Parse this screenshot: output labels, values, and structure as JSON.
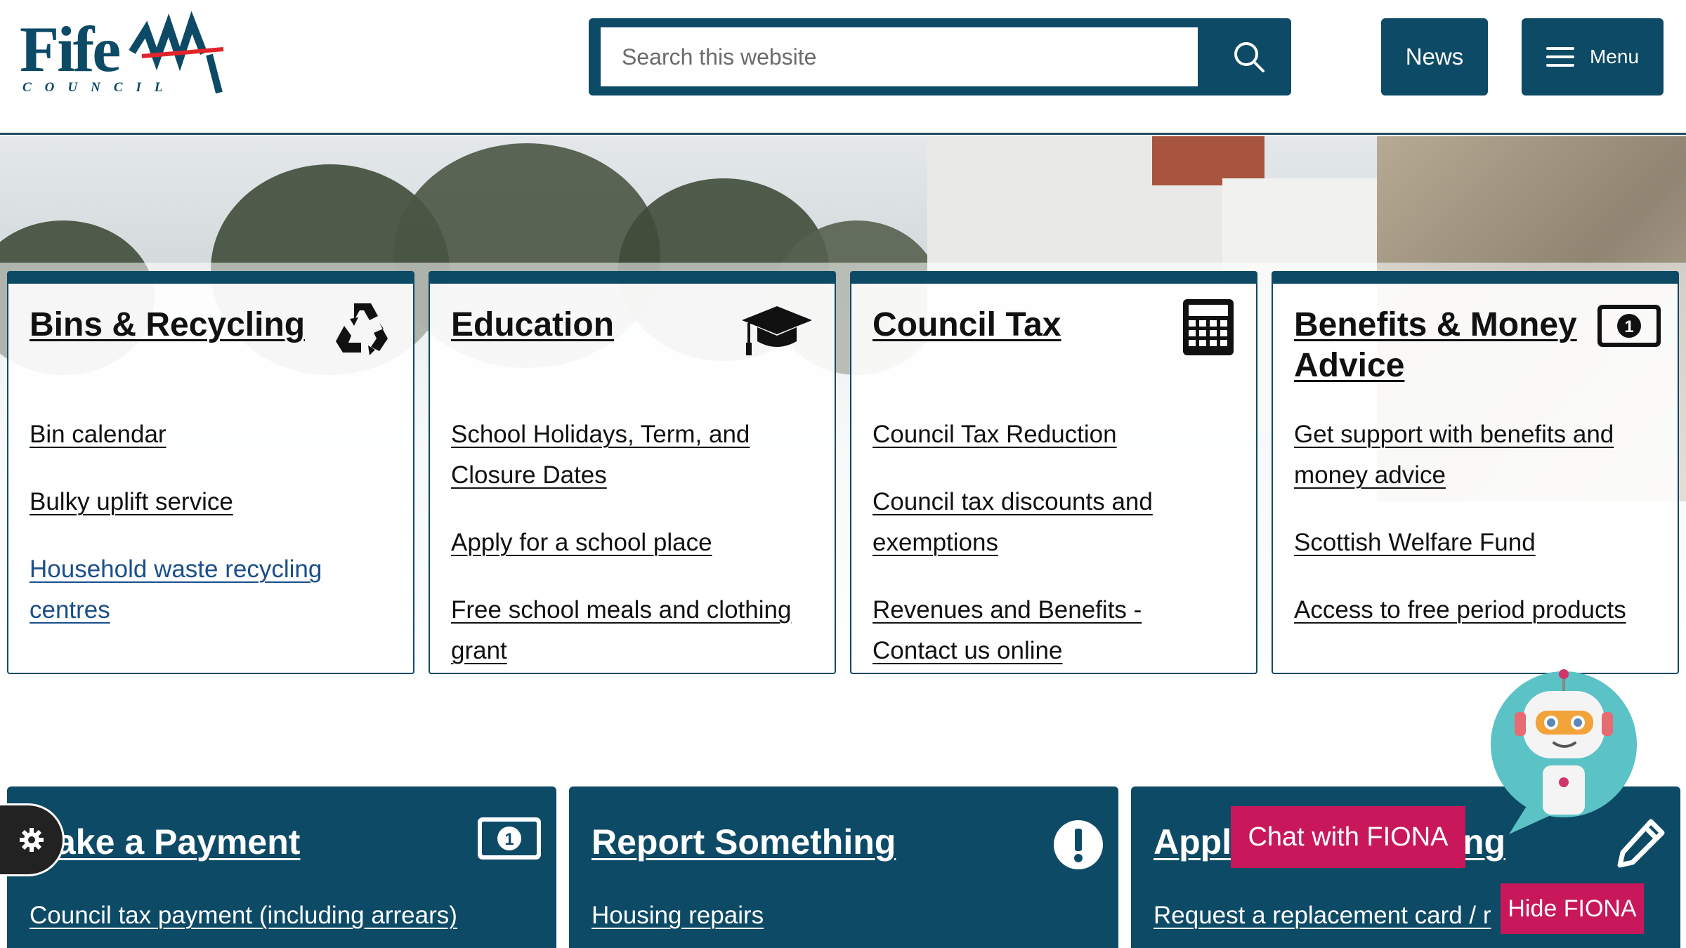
{
  "header": {
    "logo_text": "Fife",
    "logo_sub": "COUNCIL",
    "search_placeholder": "Search this website",
    "news_label": "News",
    "menu_label": "Menu"
  },
  "cards": [
    {
      "title": "Bins & Recycling",
      "icon": "recycle-icon",
      "links": [
        "Bin calendar",
        "Bulky uplift service",
        "Household waste recycling centres"
      ]
    },
    {
      "title": "Education",
      "icon": "graduation-cap-icon",
      "links": [
        "School Holidays, Term, and Closure Dates",
        "Apply for a school place",
        "Free school meals and clothing grant"
      ]
    },
    {
      "title": "Council Tax",
      "icon": "calculator-icon",
      "links": [
        "Council Tax Reduction",
        "Council tax discounts and exemptions",
        "Revenues and Benefits - Contact us online"
      ]
    },
    {
      "title": "Benefits & Money Advice",
      "icon": "banknote-icon",
      "links": [
        "Get support with benefits and money advice",
        "Scottish Welfare Fund",
        "Access to free period products"
      ]
    }
  ],
  "bottom_cards": [
    {
      "title": "ake a Payment",
      "icon": "banknote-icon",
      "link": "Council tax payment (including arrears)"
    },
    {
      "title": "Report Something",
      "icon": "exclamation-icon",
      "link": "Housing repairs"
    },
    {
      "title": "Appl",
      "title_tail": "ng",
      "icon": "pencil-icon",
      "link": "Request a replacement card / r"
    }
  ],
  "fiona": {
    "chat_label": "Chat with FIONA",
    "hide_label": "Hide FIONA"
  },
  "colors": {
    "primary": "#0d4a66",
    "accent": "#c8175a",
    "link_blue": "#1b4f8a"
  }
}
